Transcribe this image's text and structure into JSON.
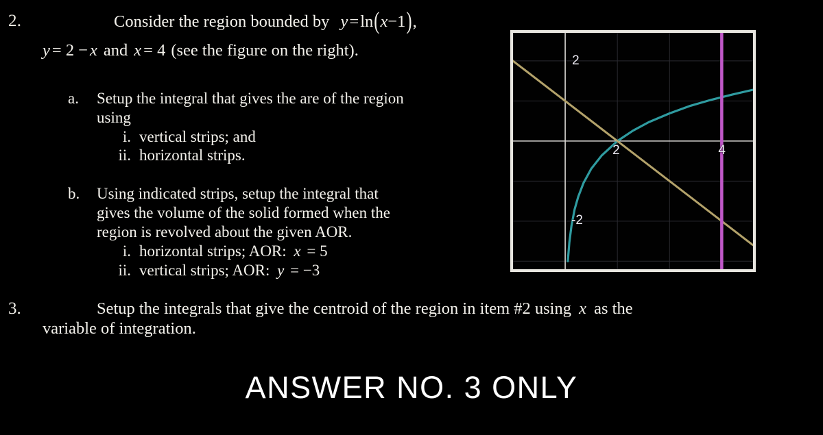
{
  "document": {
    "background_color": "#000000",
    "text_color": "#f3f1eb"
  },
  "problem2": {
    "number": "2.",
    "line1_prefix": "Consider the region bounded by",
    "line1_equation": "y = ln(x − 1),",
    "eq_y": "y",
    "eq_eq": "=",
    "eq_ln": "ln",
    "eq_lparen": "(",
    "eq_x": "x",
    "eq_minus": "−",
    "eq_one": "1",
    "eq_rparen": ")",
    "eq_comma": ",",
    "line2": "y = 2 − x  and  x = 4  (see the figure on the right).",
    "line2_y": "y",
    "line2_eq1": "= 2 −",
    "line2_x1": "x",
    "line2_and": "and",
    "line2_x2": "x",
    "line2_eq2": "= 4",
    "line2_tail": "(see the figure on the right).",
    "items": [
      {
        "label": "a.",
        "body_line1": "Setup the integral that gives the are of the region",
        "body_line2": "using",
        "subitems": [
          {
            "roman": "i.",
            "text": "vertical strips; and"
          },
          {
            "roman": "ii.",
            "text": "horizontal strips."
          }
        ]
      },
      {
        "label": "b.",
        "body_line1": "Using  indicated  strips,  setup  the  integral  that",
        "body_line2": "gives  the  volume  of  the  solid  formed  when  the",
        "body_line3": "region is revolved about the given AOR.",
        "subitems": [
          {
            "roman": "i.",
            "text_prefix": "horizontal strips; AOR:",
            "text_var": "x",
            "text_suffix": "= 5"
          },
          {
            "roman": "ii.",
            "text_prefix": "vertical strips; AOR:",
            "text_var": "y",
            "text_suffix": "= −3"
          }
        ]
      }
    ]
  },
  "problem3": {
    "number": "3.",
    "line1_a": "Setup the integrals that give the centroid of the region in item #2 using",
    "line1_var": "x",
    "line1_b": "as the",
    "line2": "variable of integration."
  },
  "banner": {
    "text": "ANSWER NO. 3 ONLY"
  },
  "chart_data": {
    "type": "line",
    "title": "",
    "xlabel": "",
    "ylabel": "",
    "xlim": [
      0,
      4.6
    ],
    "ylim": [
      -3.2,
      2.7
    ],
    "grid": true,
    "grid_color": "#2a2a30",
    "axis_color": "#d8d6d2",
    "frame_color": "#e8e6e0",
    "background": "#010101",
    "legend": "none",
    "tick_labels": [
      {
        "text": "2",
        "axis": "y",
        "value": 2
      },
      {
        "text": "-2",
        "axis": "y",
        "value": -2
      },
      {
        "text": "2",
        "axis": "x",
        "value": 2
      },
      {
        "text": "4",
        "axis": "x",
        "value": 4
      }
    ],
    "series": [
      {
        "name": "y = ln(x - 1)",
        "color": "#2f9ba0",
        "type": "curve",
        "points": [
          [
            1.05,
            -3.0
          ],
          [
            1.08,
            -2.53
          ],
          [
            1.12,
            -2.12
          ],
          [
            1.18,
            -1.71
          ],
          [
            1.25,
            -1.39
          ],
          [
            1.35,
            -1.05
          ],
          [
            1.5,
            -0.69
          ],
          [
            1.7,
            -0.36
          ],
          [
            2.0,
            0.0
          ],
          [
            2.3,
            0.26
          ],
          [
            2.6,
            0.47
          ],
          [
            3.0,
            0.69
          ],
          [
            3.4,
            0.88
          ],
          [
            3.8,
            1.03
          ],
          [
            4.2,
            1.16
          ],
          [
            4.6,
            1.28
          ]
        ]
      },
      {
        "name": "y = 2 - x",
        "color": "#b3a26a",
        "type": "line",
        "points": [
          [
            0.0,
            2.0
          ],
          [
            4.6,
            -2.6
          ]
        ]
      },
      {
        "name": "x = 4",
        "color": "#c058c8",
        "type": "vline",
        "value": 4
      }
    ]
  }
}
